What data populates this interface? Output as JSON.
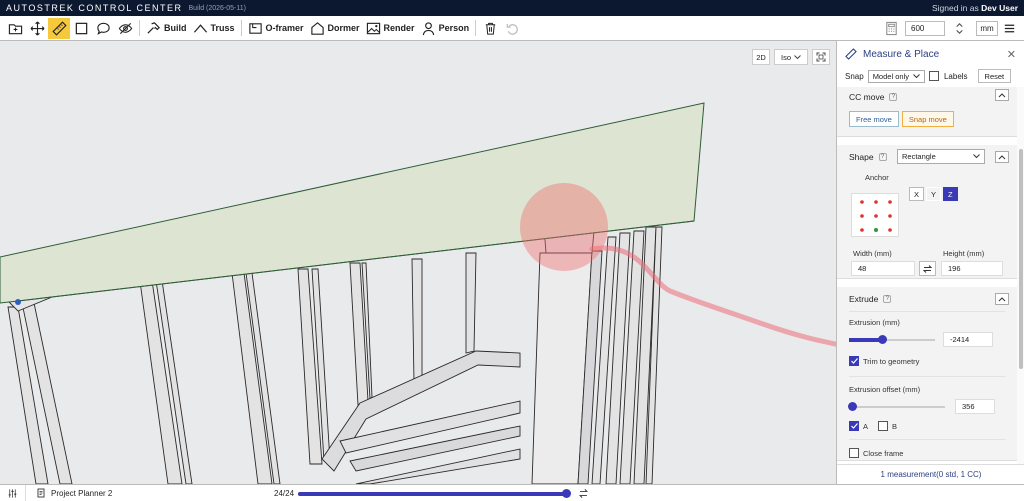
{
  "app": {
    "title": "AUTOSTREK CONTROL CENTER",
    "build": "Build (2026-05-11)",
    "signed_in_prefix": "Signed in as",
    "user": "Dev User"
  },
  "toolbar": {
    "build_label": "Build",
    "truss_label": "Truss",
    "oframer_label": "O-framer",
    "dormer_label": "Dormer",
    "render_label": "Render",
    "person_label": "Person",
    "zoom": "600",
    "units": "mm"
  },
  "viewport": {
    "view_2d": "2D",
    "view_iso": "Iso"
  },
  "panel": {
    "title": "Measure & Place",
    "snap_label": "Snap",
    "snap_value": "Model only",
    "labels_label": "Labels",
    "reset_label": "Reset",
    "cc_move": {
      "title": "CC move",
      "help": "?",
      "free_move": "Free move",
      "snap_move": "Snap move"
    },
    "shape": {
      "title": "Shape",
      "help": "?",
      "value": "Rectangle",
      "anchor_label": "Anchor",
      "axes": [
        "X",
        "Y",
        "Z"
      ],
      "active_axis": "Z",
      "width_label": "Width (mm)",
      "width_value": "48",
      "height_label": "Height (mm)",
      "height_value": "196"
    },
    "extrude": {
      "title": "Extrude",
      "help": "?",
      "extrusion_label": "Extrusion (mm)",
      "extrusion_value": "-2414",
      "extrusion_fraction": 0.38,
      "trim_label": "Trim to geometry",
      "trim_checked": true,
      "offset_label": "Extrusion offset (mm)",
      "offset_value": "356",
      "offset_fraction": 0.03,
      "a_label": "A",
      "a_checked": true,
      "b_label": "B",
      "b_checked": false,
      "close_frame_label": "Close frame",
      "close_frame_checked": false
    },
    "footer": "1 measurement(0 std, 1 CC)"
  },
  "bottom": {
    "project": "Project Planner 2",
    "page": "24/24",
    "progress_fraction": 1.0
  },
  "colors": {
    "accent": "#3a3ab8",
    "titlebar": "#0b1830",
    "active_tool": "#f6c83c",
    "panel_title": "#2d3f80",
    "snap_move_border": "#f0b040"
  }
}
